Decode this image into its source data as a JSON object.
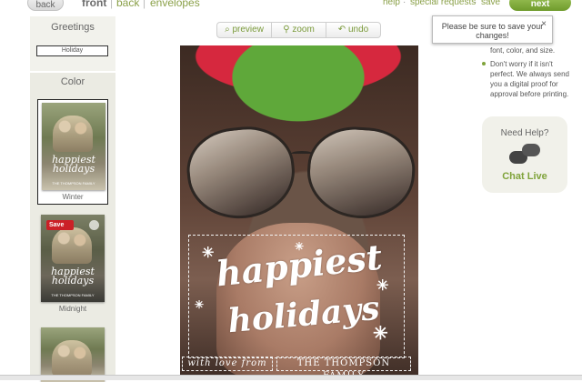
{
  "nav": {
    "back": "back",
    "tab_front": "front",
    "tab_back": "back",
    "tab_envelopes": "envelopes",
    "separator": "|",
    "help": "help",
    "special_requests": "special requests",
    "save": "save",
    "next": "next",
    "dot": "·"
  },
  "tooltip": {
    "text": "Please be sure to save your changes!",
    "close": "×"
  },
  "sidebar": {
    "greetings_title": "Greetings",
    "greeting_selected": "Holiday",
    "color_title": "Color",
    "thumbnails": [
      {
        "label": "Winter",
        "script": "happiest holidays",
        "family": "THE THOMPSON FAMILY"
      },
      {
        "label": "Midnight",
        "script": "happiest holidays",
        "family": "THE THOMPSON FAMILY"
      },
      {
        "label": "",
        "script": "",
        "family": ""
      }
    ],
    "pin_save": "Save"
  },
  "toolbar": {
    "preview": "preview",
    "zoom": "zoom",
    "undo": "undo",
    "preview_icon": "magnifier-icon",
    "zoom_icon": "zoom-icon",
    "undo_icon": "undo-arrow-icon"
  },
  "card": {
    "greeting_line1": "happiest",
    "greeting_line2": "holidays",
    "signoff_italic": "with love from",
    "family_name": "THE THOMPSON FAMILY"
  },
  "tips": {
    "partial": "font, color, and size.",
    "tip2": "Don't worry if it isn't perfect. We always send you a digital proof for approval before printing."
  },
  "help": {
    "question": "Need Help?",
    "chat": "Chat Live",
    "icon": "chat-bubbles-icon"
  },
  "colors": {
    "accent_green": "#7fa33a",
    "next_button": "#6f9b2c",
    "pinterest_red": "#cb2027"
  }
}
